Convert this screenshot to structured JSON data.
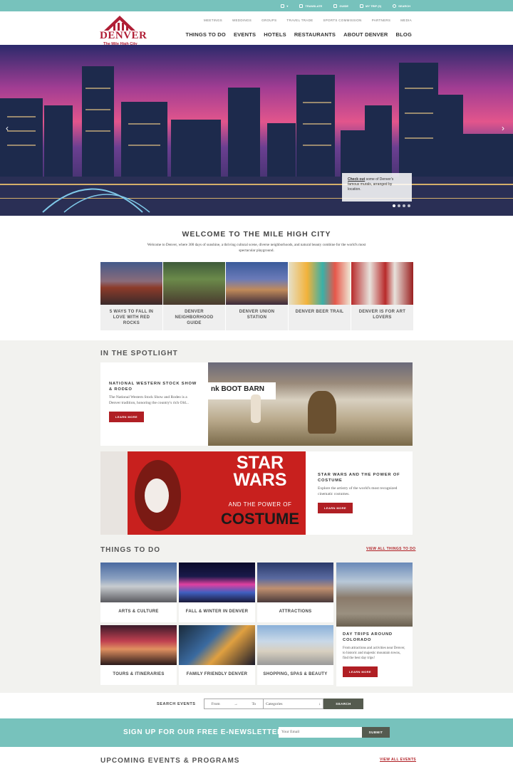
{
  "utility_bar": [
    {
      "label": "",
      "icon": "language-icon"
    },
    {
      "label": "TRANSLATE",
      "icon": "translate-icon"
    },
    {
      "label": "GUIDE",
      "icon": "book-icon"
    },
    {
      "label": "MY TRIP (0)",
      "icon": "suitcase-icon"
    },
    {
      "label": "SEARCH",
      "icon": "search-icon"
    }
  ],
  "logo": {
    "word": "DENVER",
    "tagline": "The Mile High City"
  },
  "subnav": [
    "MEETINGS",
    "WEDDINGS",
    "GROUPS",
    "TRAVEL TRADE",
    "SPORTS COMMISSION",
    "PARTNERS",
    "MEDIA"
  ],
  "mainnav": [
    "THINGS TO DO",
    "EVENTS",
    "HOTELS",
    "RESTAURANTS",
    "ABOUT DENVER",
    "BLOG"
  ],
  "hero": {
    "caption_link": "Check out",
    "caption_text": "some of Denver's famous murals, arranged by location.",
    "slides": 4,
    "active_slide": 1
  },
  "welcome": {
    "title": "WELCOME TO THE MILE HIGH CITY",
    "text": "Welcome to Denver, where 300 days of sunshine, a thriving cultural scene, diverse neighborhoods, and natural beauty combine for the world's most spectacular playground."
  },
  "feature_cards": [
    {
      "label": "5 WAYS TO FALL IN LOVE WITH RED ROCKS"
    },
    {
      "label": "DENVER NEIGHBORHOOD GUIDE"
    },
    {
      "label": "DENVER UNION STATION"
    },
    {
      "label": "DENVER BEER TRAIL"
    },
    {
      "label": "DENVER IS FOR ART LOVERS"
    }
  ],
  "spotlight": {
    "title": "IN THE SPOTLIGHT",
    "items": [
      {
        "title": "NATIONAL WESTERN STOCK SHOW & RODEO",
        "desc": "The National Western Stock Show and Rodeo is a Denver tradition, honoring the country's rich Old...",
        "button": "LEARN MORE"
      },
      {
        "title": "STAR WARS AND THE POWER OF COSTUME",
        "desc": "Explore the artistry of the world's most recognized cinematic costumes.",
        "button": "LEARN MORE"
      }
    ],
    "poster": {
      "line1": "STAR",
      "line2": "WARS",
      "line3": "AND THE POWER OF",
      "line4": "COSTUME"
    },
    "rodeo_banner": "nk BOOT BARN"
  },
  "things_to_do": {
    "title": "THINGS TO DO",
    "view_all": "VIEW ALL THINGS TO DO",
    "cards": [
      {
        "label": "ARTS & CULTURE"
      },
      {
        "label": "FALL & WINTER IN DENVER"
      },
      {
        "label": "ATTRACTIONS"
      },
      {
        "label": "TOURS & ITINERARIES"
      },
      {
        "label": "FAMILY FRIENDLY DENVER"
      },
      {
        "label": "SHOPPING, SPAS & BEAUTY"
      }
    ],
    "day_trips": {
      "title": "DAY TRIPS AROUND COLORADO",
      "desc": "From attractions and activities near Denver, to historic and majestic mountain towns, find the best day trips!",
      "button": "LEARN MORE"
    }
  },
  "search_events": {
    "label": "SEARCH EVENTS",
    "from": "From",
    "to": "To",
    "categories": "Categories",
    "button": "SEARCH"
  },
  "newsletter": {
    "title": "SIGN UP FOR OUR FREE E-NEWSLETTER",
    "placeholder": "Your Email",
    "button": "SUBMIT"
  },
  "upcoming": {
    "title": "UPCOMING EVENTS & PROGRAMS",
    "view_all": "VIEW ALL EVENTS"
  },
  "colors": {
    "teal": "#77c2bc",
    "red": "#b01f24",
    "brand": "#b01f36",
    "dark_button": "#555b4f"
  }
}
